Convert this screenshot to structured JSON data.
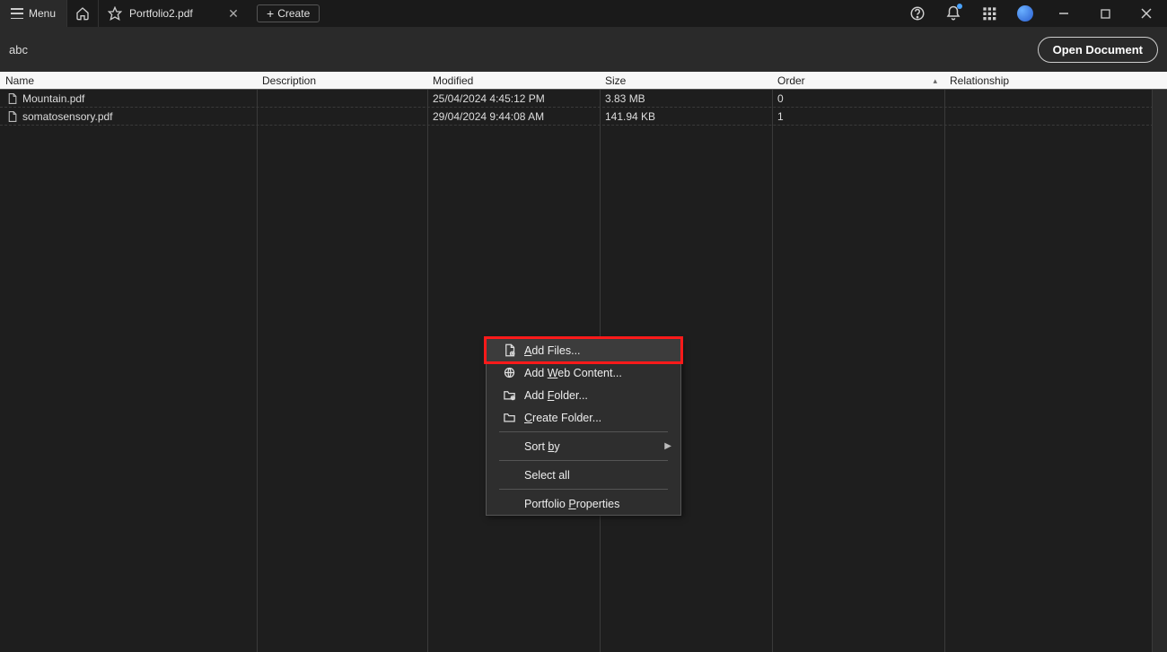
{
  "titlebar": {
    "menu_label": "Menu",
    "tab_title": "Portfolio2.pdf",
    "create_label": "Create"
  },
  "toolbar": {
    "breadcrumb": "abc",
    "open_document_label": "Open Document"
  },
  "columns": {
    "name": "Name",
    "description": "Description",
    "modified": "Modified",
    "size": "Size",
    "order": "Order",
    "relationship": "Relationship"
  },
  "rows": [
    {
      "name": "Mountain.pdf",
      "description": "",
      "modified": "25/04/2024 4:45:12 PM",
      "size": "3.83 MB",
      "order": "0",
      "relationship": ""
    },
    {
      "name": "somatosensory.pdf",
      "description": "",
      "modified": "29/04/2024 9:44:08 AM",
      "size": "141.94 KB",
      "order": "1",
      "relationship": ""
    }
  ],
  "context_menu": {
    "add_files": "Add Files...",
    "add_web": "Add Web Content...",
    "add_folder": "Add Folder...",
    "create_folder": "Create Folder...",
    "sort_by": "Sort by",
    "select_all": "Select all",
    "portfolio_props": "Portfolio Properties"
  }
}
